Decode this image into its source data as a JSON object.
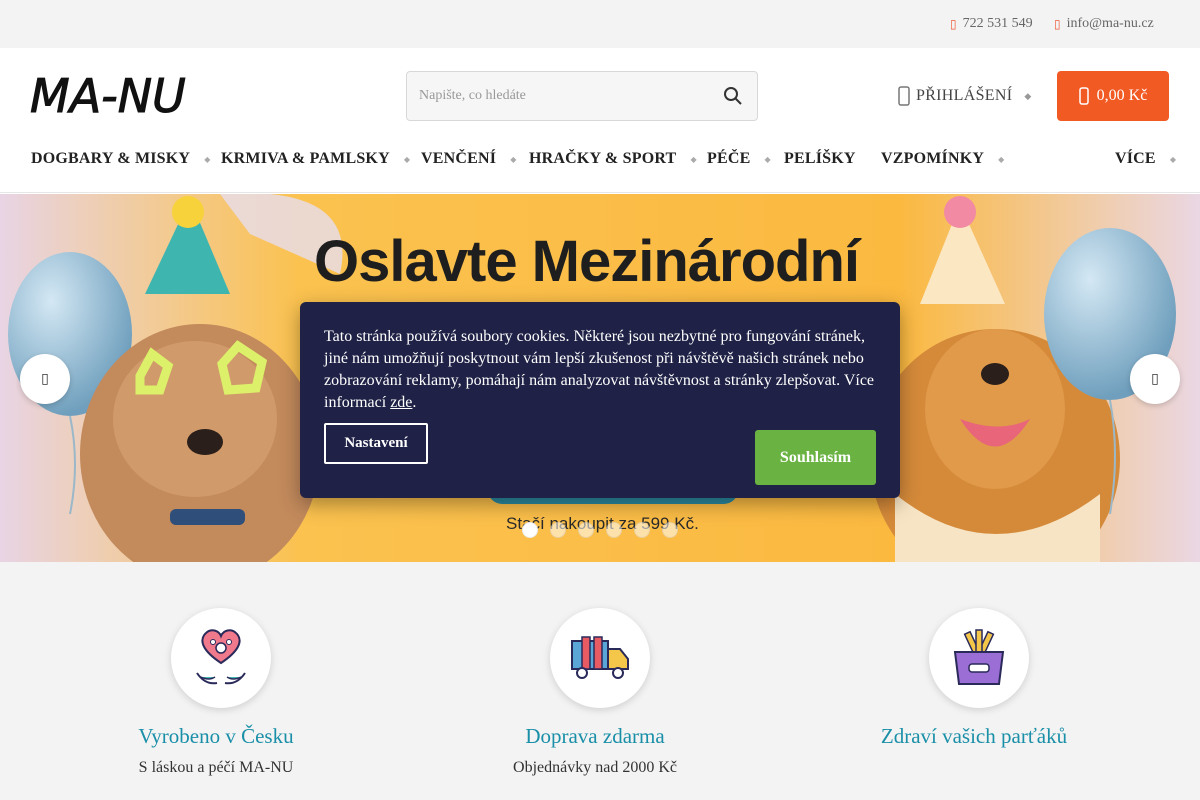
{
  "topbar": {
    "phone": "722 531 549",
    "email": "info@ma-nu.cz"
  },
  "header": {
    "logo_text": "MA-NU",
    "search_placeholder": "Napište, co hledáte",
    "login_label": "PŘIHLÁŠENÍ",
    "cart_total": "0,00 Kč"
  },
  "nav": {
    "items": [
      {
        "label": "DOGBARY & MISKY",
        "has_dropdown": true
      },
      {
        "label": "KRMIVA & PAMLSKY",
        "has_dropdown": true
      },
      {
        "label": "VENČENÍ",
        "has_dropdown": true
      },
      {
        "label": "HRAČKY & SPORT",
        "has_dropdown": true
      },
      {
        "label": "PÉČE",
        "has_dropdown": true
      },
      {
        "label": "PELÍŠKY",
        "has_dropdown": false
      },
      {
        "label": "VZPOMÍNKY",
        "has_dropdown": true
      },
      {
        "label": "VÍCE",
        "has_dropdown": true
      }
    ]
  },
  "hero": {
    "title": "Oslavte Mezinárodní",
    "subtitle": "Stačí nakoupit za 599 Kč.",
    "slide_count": 6,
    "active_slide": 1
  },
  "cookie": {
    "text": "Tato stránka používá soubory cookies. Některé jsou nezbytné pro fungování stránek, jiné nám umožňují poskytnout vám lepší zkušenost při návštěvě našich stránek nebo zobrazování reklamy, pomáhají nám analyzovat návštěvnost a stránky zlepšovat. Více informací",
    "link_label": "zde",
    "link_suffix": ".",
    "settings_label": "Nastavení",
    "accept_label": "Souhlasím"
  },
  "benefits": [
    {
      "icon": "heart-paw-hands-icon",
      "title": "Vyrobeno v Česku",
      "subtitle": "S láskou a péčí MA-NU"
    },
    {
      "icon": "delivery-truck-icon",
      "title": "Doprava zdarma",
      "subtitle": "Objednávky nad 2000 Kč"
    },
    {
      "icon": "dog-bowl-bones-icon",
      "title": "Zdraví vašich parťáků",
      "subtitle": ""
    }
  ],
  "colors": {
    "accent": "#f25a24",
    "accept": "#6ab343",
    "dialog": "#1f2246",
    "benefit_title": "#1a8fa8"
  }
}
